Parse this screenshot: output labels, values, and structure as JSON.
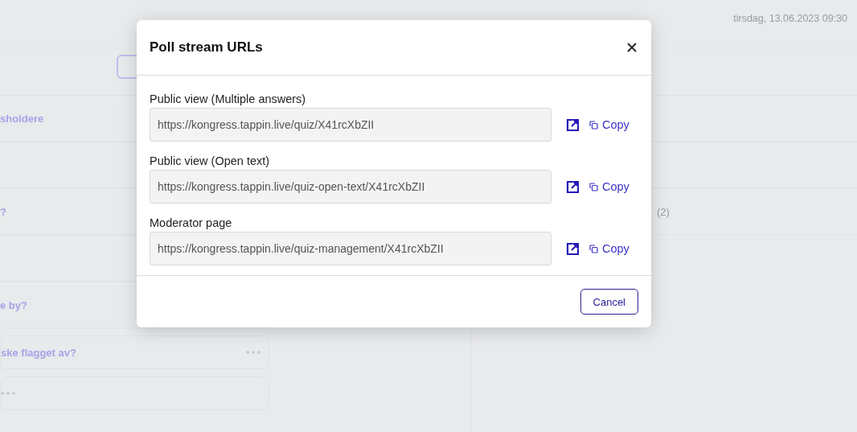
{
  "background": {
    "date": "tirsdag, 13.06.2023 09:30",
    "left_rows": [
      {
        "kind": "row",
        "text": "sholdere"
      },
      {
        "kind": "row"
      },
      {
        "kind": "row",
        "text": "?"
      },
      {
        "kind": "row"
      },
      {
        "kind": "row",
        "text": "e by?"
      },
      {
        "kind": "card",
        "text": "ske flagget av?"
      },
      {
        "kind": "card"
      }
    ],
    "right_rows": [
      {
        "kind": "row"
      },
      {
        "kind": "row"
      },
      {
        "kind": "row",
        "text": "(2)"
      }
    ]
  },
  "dialog": {
    "title": "Poll stream URLs",
    "urls": [
      {
        "label": "Public view (Multiple answers)",
        "value": "https://kongress.tappin.live/quiz/X41rcXbZII",
        "action": "Copy"
      },
      {
        "label": "Public view (Open text)",
        "value": "https://kongress.tappin.live/quiz-open-text/X41rcXbZII",
        "action": "Copy"
      },
      {
        "label": "Moderator page",
        "value": "https://kongress.tappin.live/quiz-management/X41rcXbZII",
        "action": "Copy"
      }
    ],
    "buttons": [
      "Cancel"
    ]
  }
}
